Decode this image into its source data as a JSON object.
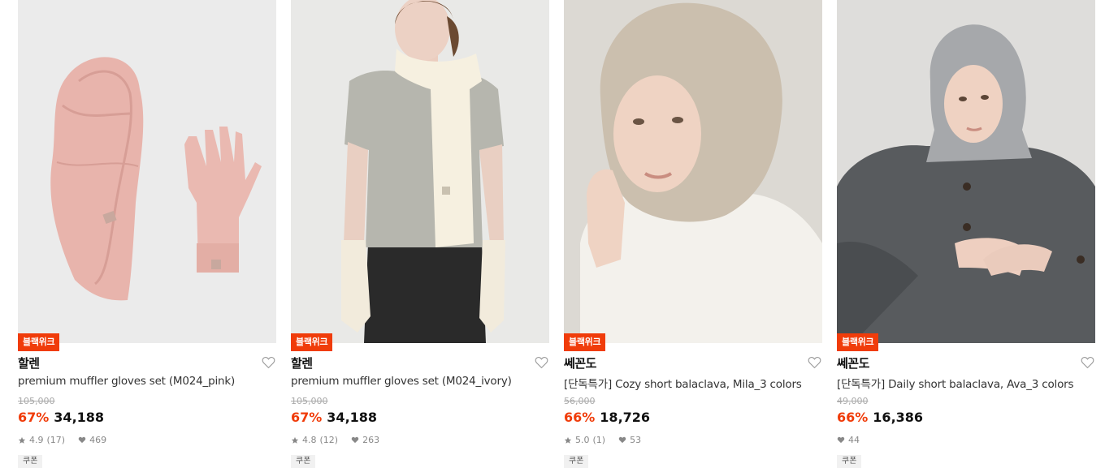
{
  "products": [
    {
      "badge": "블랙위크",
      "brand": "할렌",
      "name": "premium muffler gloves set (M024_pink)",
      "original_price": "105,000",
      "discount": "67%",
      "price": "34,188",
      "rating": "4.9",
      "reviews": "(17)",
      "likes": "469",
      "coupon": "쿠폰",
      "image_subject": "pink knit scarf and gloves"
    },
    {
      "badge": "블랙위크",
      "brand": "할렌",
      "name": "premium muffler gloves set (M024_ivory)",
      "original_price": "105,000",
      "discount": "67%",
      "price": "34,188",
      "rating": "4.8",
      "reviews": "(12)",
      "likes": "263",
      "coupon": "쿠폰",
      "image_subject": "model with ivory scarf and gloves"
    },
    {
      "badge": "블랙위크",
      "brand": "쎄꼰도",
      "name": "[단독특가] Cozy short balaclava, Mila_3 colors",
      "original_price": "56,000",
      "discount": "66%",
      "price": "18,726",
      "rating": "5.0",
      "reviews": "(1)",
      "likes": "53",
      "coupon": "쿠폰",
      "image_subject": "model in beige fuzzy balaclava"
    },
    {
      "badge": "블랙위크",
      "brand": "쎄꼰도",
      "name": "[단독특가] Daily short balaclava, Ava_3 colors",
      "original_price": "49,000",
      "discount": "66%",
      "price": "16,386",
      "likes": "44",
      "coupon": "쿠폰",
      "image_subject": "model in grey knit balaclava and coat"
    }
  ],
  "icons": {
    "heart": "heart-outline-icon",
    "star": "star-icon",
    "like": "heart-filled-icon"
  },
  "colors": {
    "accent": "#f03c0a",
    "text": "#111111",
    "muted": "#888888"
  }
}
